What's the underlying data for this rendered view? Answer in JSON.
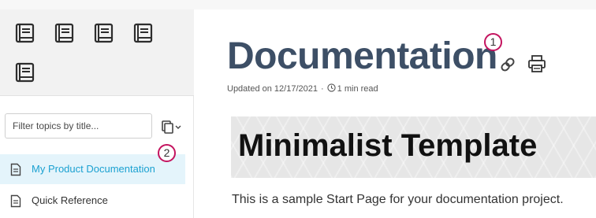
{
  "sidebar": {
    "books": [
      "book-1",
      "book-2",
      "book-3",
      "book-4",
      "book-5"
    ],
    "filter": {
      "placeholder": "Filter topics by title...",
      "value": ""
    },
    "items": [
      {
        "label": "My Product Documentation",
        "active": true
      },
      {
        "label": "Quick Reference",
        "active": false
      }
    ]
  },
  "badges": {
    "first": "1",
    "second": "2"
  },
  "main": {
    "title": "Documentation",
    "updated": "Updated on 12/17/2021",
    "separator": "·",
    "read_time": "1 min read",
    "hero_title": "Minimalist Template",
    "intro": "This is a sample Start Page for your documentation project."
  },
  "colors": {
    "accent": "#1ba1d1",
    "title": "#3d4f66",
    "badge": "#c4145f",
    "active_bg": "#e4f4fb"
  },
  "icons": [
    "book-icon",
    "copy-icon",
    "chevron-down-icon",
    "document-icon",
    "link-icon",
    "print-icon",
    "clock-icon"
  ]
}
